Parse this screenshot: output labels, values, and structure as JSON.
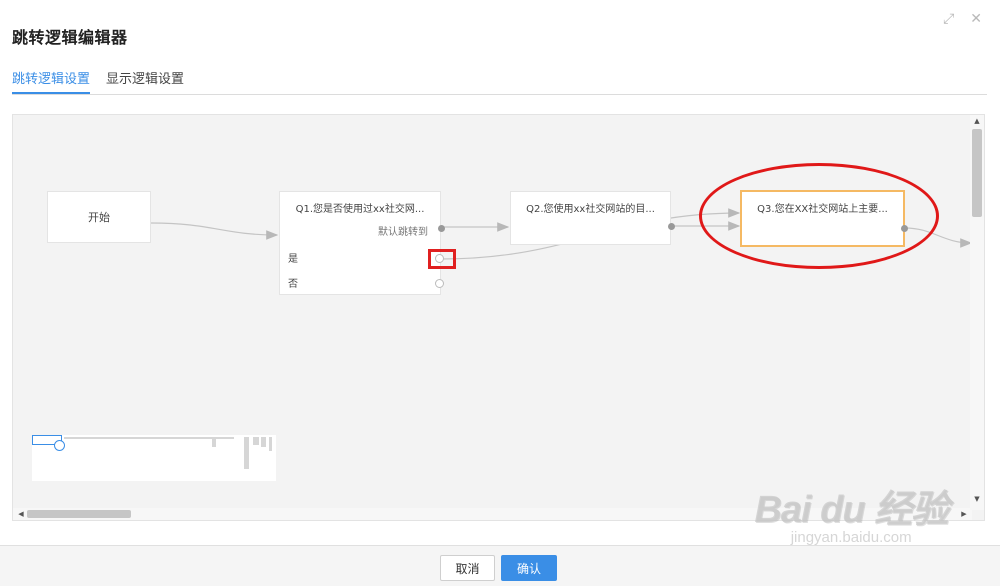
{
  "dialog": {
    "title": "跳转逻辑编辑器",
    "expand_glyph": "⤢",
    "close_glyph": "✕"
  },
  "tabs": [
    {
      "label": "跳转逻辑设置",
      "active": true
    },
    {
      "label": "显示逻辑设置",
      "active": false
    }
  ],
  "flow": {
    "start_node": {
      "label": "开始"
    },
    "q1": {
      "title": "Q1.您是否使用过xx社交网...",
      "default_jump": "默认跳转到",
      "options": [
        "是",
        "否"
      ]
    },
    "q2": {
      "title": "Q2.您使用xx社交网站的目..."
    },
    "q3": {
      "title": "Q3.您在XX社交网站上主要..."
    }
  },
  "footer": {
    "cancel_label": "取消",
    "confirm_label": "确认"
  },
  "watermark": {
    "logo": "Bai du 经验",
    "sub": "jingyan.baidu.com"
  },
  "colors": {
    "accent": "#3a8ee6",
    "highlight_node_border": "#f5b963",
    "annotation_red": "#e01818"
  }
}
